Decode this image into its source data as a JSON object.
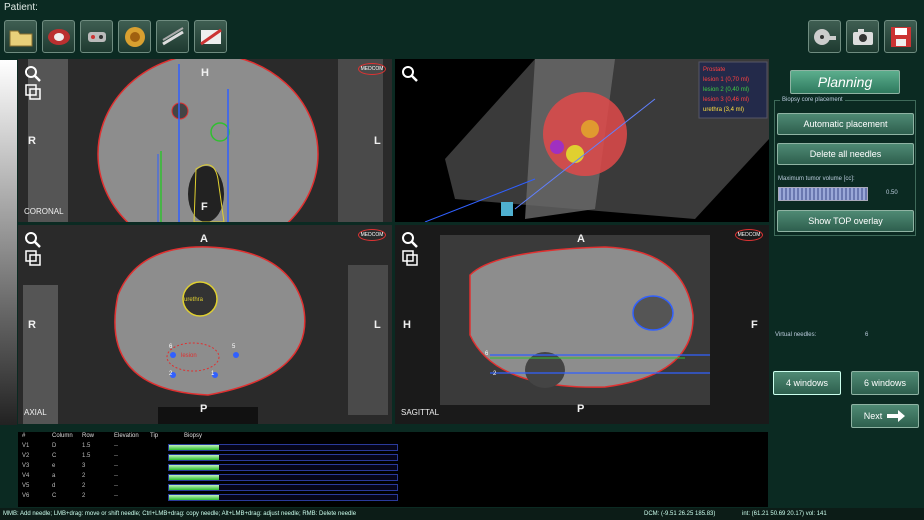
{
  "patient_label": "Patient:",
  "toolbar": [
    "folder-icon",
    "axial-slice-icon",
    "robot-arm-icon",
    "prostate-3d-icon",
    "needle-guide-icon",
    "probe-icon"
  ],
  "right_toolbar": [
    "film-reel-icon",
    "camera-icon",
    "save-disk-icon"
  ],
  "views": {
    "coronal": {
      "name": "CORONAL",
      "top": "H",
      "bottom": "F",
      "left": "R",
      "right": "L"
    },
    "axial": {
      "name": "AXIAL",
      "top": "A",
      "bottom": "P",
      "left": "R",
      "right": "L"
    },
    "sagittal": {
      "name": "SAGITTAL",
      "top": "A",
      "bottom": "P",
      "left": "H",
      "right": "F"
    },
    "logo": "MEDCOM"
  },
  "legend": [
    {
      "text": "Prostate",
      "color": "#ff4040"
    },
    {
      "text": "lesion 1 (0,70 ml)",
      "color": "#ff4040"
    },
    {
      "text": "lesion 2 (0,40 ml)",
      "color": "#40d040"
    },
    {
      "text": "lesion 3 (0,46 ml)",
      "color": "#ff4040"
    },
    {
      "text": "urethra (3,4 ml)",
      "color": "#ffe040"
    }
  ],
  "axial_labels": {
    "urethra": "urethra",
    "lesion": "lesion"
  },
  "needle_numbers": [
    "1",
    "2",
    "3",
    "4",
    "5",
    "6"
  ],
  "panel": {
    "planning": "Planning",
    "section": "Biopsy core placement",
    "auto_btn": "Automatic placement",
    "delete_btn": "Delete all needles",
    "tumor_label": "Maximum tumor volume [cc]:",
    "tumor_value": "0.50",
    "overlay_btn": "Show TOP overlay",
    "virtual_label": "Virtual needles:",
    "virtual_count": "6",
    "win4": "4 windows",
    "win6": "6 windows",
    "next": "Next"
  },
  "table": {
    "headers": [
      "#",
      "Column",
      "Row",
      "Elevation",
      "Tip",
      "Biopsy"
    ],
    "rows": [
      [
        "V1",
        "D",
        "1.5",
        "--",
        ""
      ],
      [
        "V2",
        "C",
        "1.5",
        "--",
        ""
      ],
      [
        "V3",
        "e",
        "3",
        "--",
        ""
      ],
      [
        "V4",
        "a",
        "2",
        "--",
        ""
      ],
      [
        "V5",
        "d",
        "2",
        "--",
        ""
      ],
      [
        "V6",
        "C",
        "2",
        "--",
        ""
      ]
    ],
    "progress": [
      0.22,
      0.22,
      0.22,
      0.22,
      0.22,
      0.22
    ]
  },
  "status": {
    "help": "MMB: Add needle; LMB+drag: move or shift needle; Ctrl+LMB+drag: copy needle; Alt+LMB+drag: adjust needle; RMB: Delete needle",
    "dcm": "DCM: (-9.51 26.25 185.83)",
    "int": "int: (61.21 50.69 20.17) vol: 141"
  },
  "colors": {
    "prostate": "#e03030",
    "needle": "#3060ff",
    "lesion_green": "#30c030",
    "urethra": "#e0d030"
  }
}
